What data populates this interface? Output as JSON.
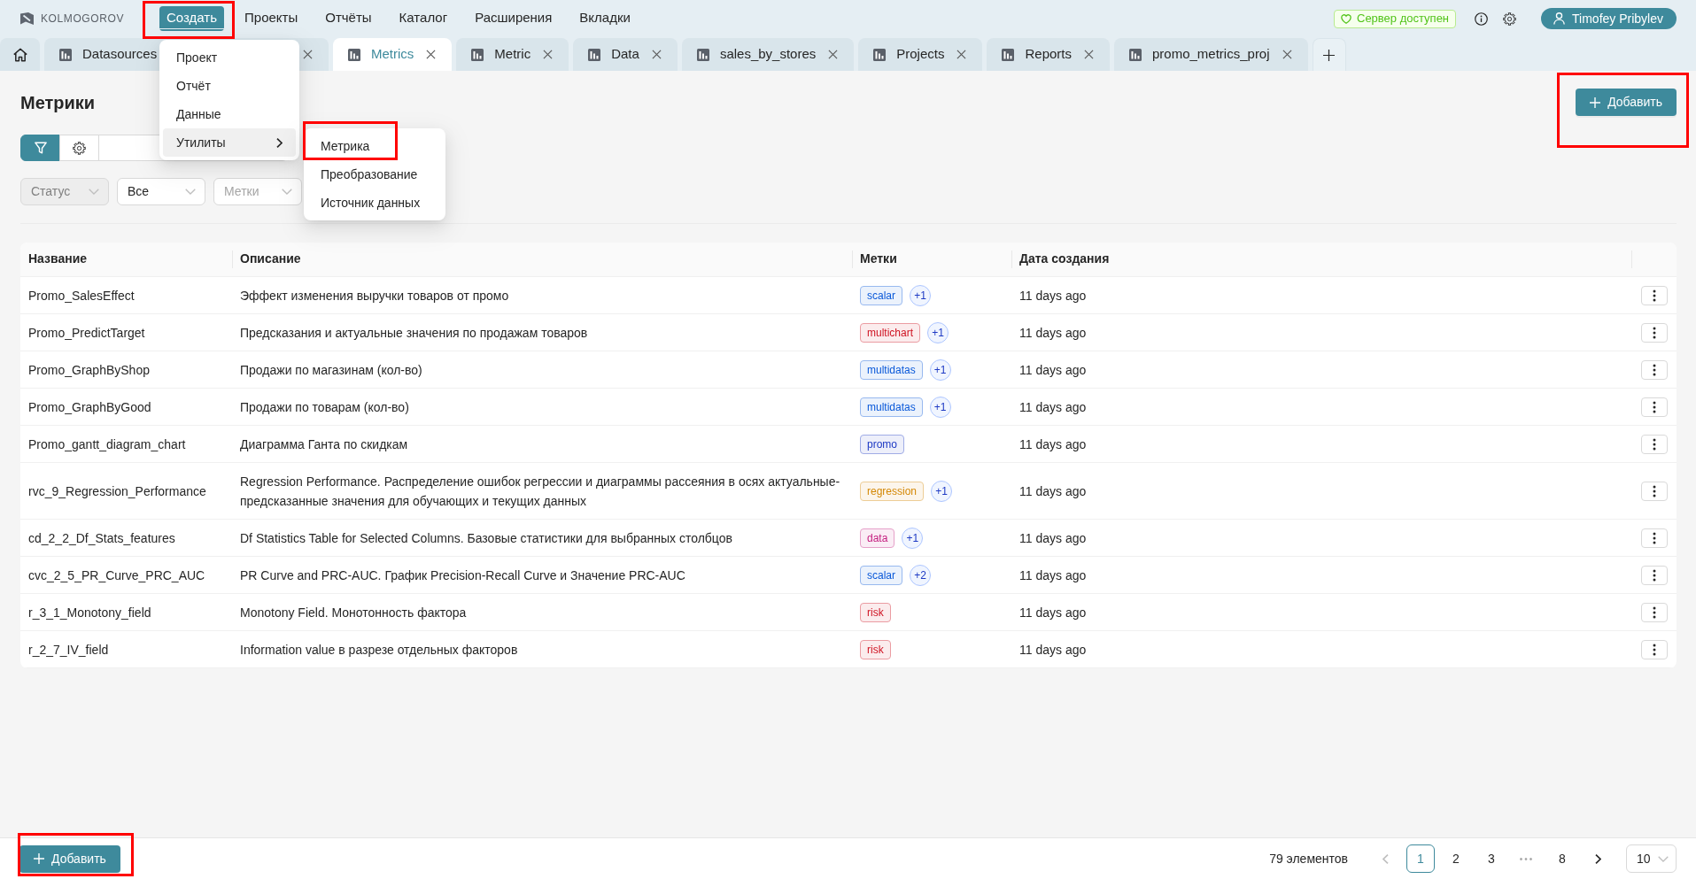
{
  "header": {
    "logo": "KOLMOGOROV",
    "menu": [
      {
        "label": "Создать",
        "selected": true,
        "highlighted": true
      },
      {
        "label": "Проекты",
        "selected": false,
        "highlighted": false
      },
      {
        "label": "Отчёты",
        "selected": false,
        "highlighted": false
      },
      {
        "label": "Каталог",
        "selected": false,
        "highlighted": false
      },
      {
        "label": "Расширения",
        "selected": false,
        "highlighted": false
      },
      {
        "label": "Вкладки",
        "selected": false,
        "highlighted": false
      }
    ],
    "server_status": "Сервер доступен",
    "user": "Timofey Pribylev"
  },
  "tabs": [
    {
      "kind": "home",
      "selected": false
    },
    {
      "kind": "page",
      "label": "Datasources",
      "selected": false
    },
    {
      "kind": "page",
      "label": "Metrics",
      "selected": true
    },
    {
      "kind": "page",
      "label": "Metric",
      "selected": false
    },
    {
      "kind": "page",
      "label": "Data",
      "selected": false
    },
    {
      "kind": "page",
      "label": "sales_by_stores",
      "selected": false
    },
    {
      "kind": "page",
      "label": "Projects",
      "selected": false
    },
    {
      "kind": "page",
      "label": "Reports",
      "selected": false
    },
    {
      "kind": "page",
      "label": "promo_metrics_proj",
      "selected": false
    },
    {
      "kind": "new",
      "selected": false
    }
  ],
  "create_menu": {
    "items": [
      {
        "kind": "item",
        "label": "Проект",
        "expanded": false
      },
      {
        "kind": "item",
        "label": "Отчёт",
        "expanded": false
      },
      {
        "kind": "item",
        "label": "Данные",
        "expanded": false
      },
      {
        "kind": "submenu",
        "label": "Утилиты",
        "expanded": true,
        "children": [
          {
            "label": "Метрика",
            "highlighted": true
          },
          {
            "label": "Преобразование",
            "highlighted": false
          },
          {
            "label": "Источник данных",
            "highlighted": false
          }
        ]
      }
    ]
  },
  "page": {
    "title": "Метрики",
    "add_button": {
      "label": "Добавить",
      "highlighted": true
    }
  },
  "toolbar": [
    {
      "kind": "filter",
      "selected": true
    },
    {
      "kind": "settings",
      "selected": false
    }
  ],
  "filters": [
    {
      "placeholder": "Статус",
      "disabled": true
    },
    {
      "value": "Все",
      "disabled": false
    },
    {
      "placeholder": "Метки",
      "disabled": false
    }
  ],
  "table": {
    "columns": [
      "Название",
      "Описание",
      "Метки",
      "Дата создания"
    ],
    "rows": [
      {
        "name": "Promo_SalesEffect",
        "description": "Эффект изменения выручки товаров от промо",
        "tag": {
          "label": "scalar",
          "color": "#0958d9"
        },
        "more": "+1",
        "created": "11 days ago"
      },
      {
        "name": "Promo_PredictTarget",
        "description": "Предсказания и актуальные значения по продажам товаров",
        "tag": {
          "label": "multichart",
          "color": "#cf1322"
        },
        "more": "+1",
        "created": "11 days ago"
      },
      {
        "name": "Promo_GraphByShop",
        "description": "Продажи по магазинам (кол-во)",
        "tag": {
          "label": "multidatas",
          "color": "#0958d9"
        },
        "more": "+1",
        "created": "11 days ago"
      },
      {
        "name": "Promo_GraphByGood",
        "description": "Продажи по товарам (кол-во)",
        "tag": {
          "label": "multidatas",
          "color": "#0958d9"
        },
        "more": "+1",
        "created": "11 days ago"
      },
      {
        "name": "Promo_gantt_diagram_chart",
        "description": "Диаграмма Ганта по скидкам",
        "tag": {
          "label": "promo",
          "color": "#1d39c4"
        },
        "created": "11 days ago"
      },
      {
        "name": "rvc_9_Regression_Performance",
        "description": "Regression Performance. Распределение ошибок регрессии и диаграммы рассеяния в осях актуальные-предсказанные значения для обучающих и текущих данных",
        "tag": {
          "label": "regression",
          "color": "#d48806"
        },
        "more": "+1",
        "created": "11 days ago"
      },
      {
        "name": "cd_2_2_Df_Stats_features",
        "description": "Df Statistics Table for Selected Columns. Базовые статистики для выбранных столбцов",
        "tag": {
          "label": "data",
          "color": "#c41d7f"
        },
        "more": "+1",
        "created": "11 days ago"
      },
      {
        "name": "cvc_2_5_PR_Curve_PRC_AUC",
        "description": "PR Curve and PRC-AUC. График Precision-Recall Curve и Значение PRC-AUC",
        "tag": {
          "label": "scalar",
          "color": "#0958d9"
        },
        "more": "+2",
        "created": "11 days ago"
      },
      {
        "name": "r_3_1_Monotony_field",
        "description": "Monotony Field. Монотонность фактора",
        "tag": {
          "label": "risk",
          "color": "#cf1322"
        },
        "created": "11 days ago"
      },
      {
        "name": "r_2_7_IV_field",
        "description": "Information value в разрезе отдельных факторов",
        "tag": {
          "label": "risk",
          "color": "#cf1322"
        },
        "created": "11 days ago"
      }
    ]
  },
  "footer": {
    "add_button": {
      "label": "Добавить",
      "highlighted": true
    },
    "total": "79 элементов",
    "prev": {
      "disabled": true
    },
    "pages": [
      {
        "kind": "page",
        "label": "1",
        "selected": true
      },
      {
        "kind": "page",
        "label": "2",
        "selected": false
      },
      {
        "kind": "page",
        "label": "3",
        "selected": false
      },
      {
        "kind": "ellipsis",
        "label": "•••",
        "selected": false
      },
      {
        "kind": "page",
        "label": "8",
        "selected": false
      }
    ],
    "next": {
      "disabled": false
    },
    "page_size": "10"
  }
}
